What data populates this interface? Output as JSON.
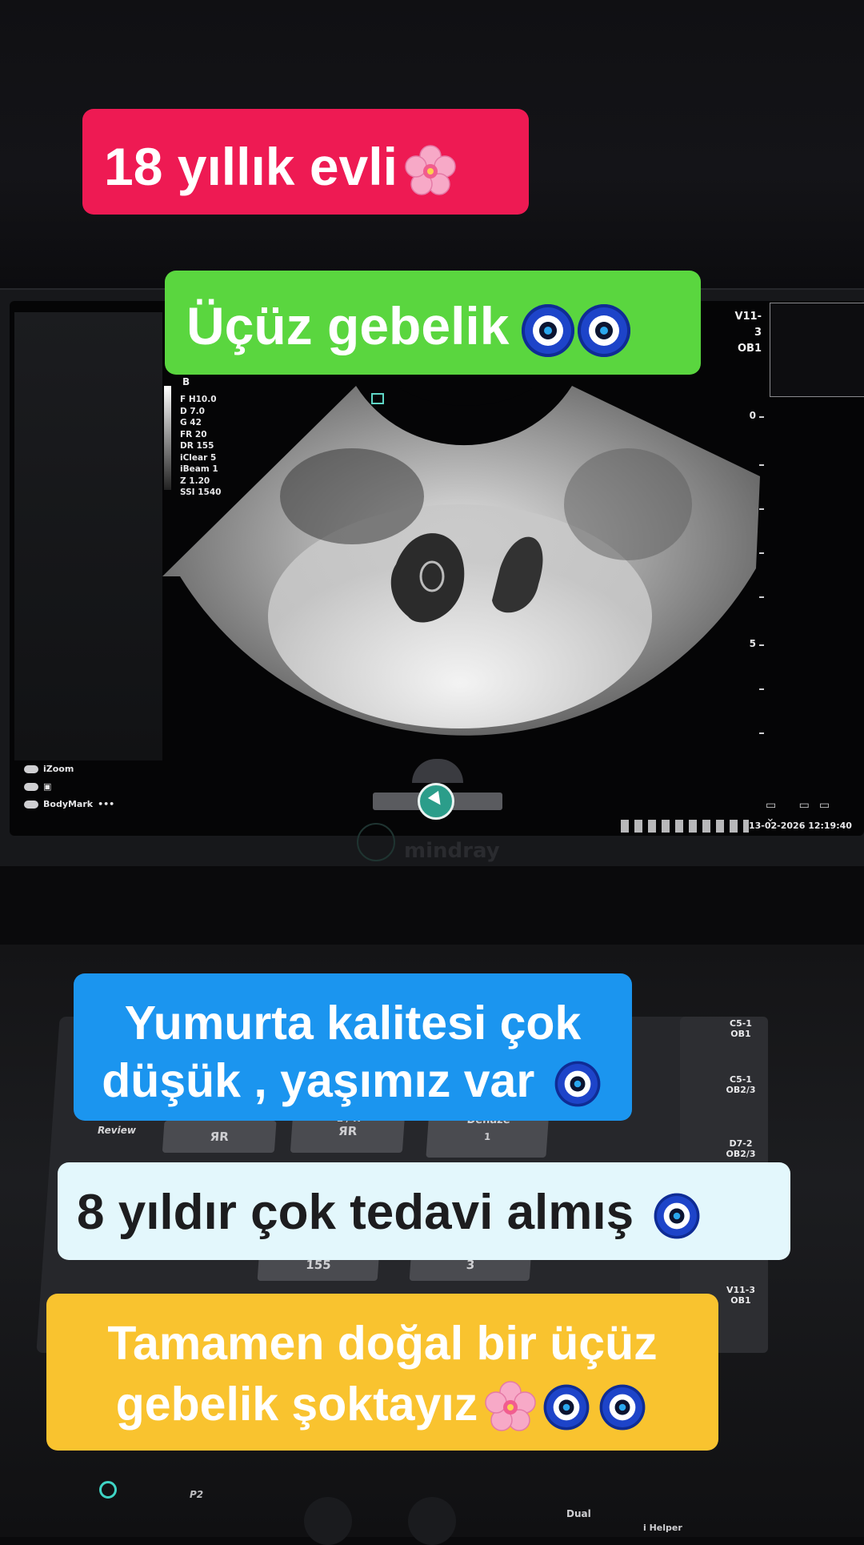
{
  "captions": {
    "c1": "18 yıllık evli",
    "c2": "Üçüz gebelik",
    "c3_line1": "Yumurta kalitesi çok",
    "c3_line2": "düşük , yaşımız var",
    "c4": "8 yıldır çok tedavi almış",
    "c5_line1": "Tamamen doğal bir üçüz",
    "c5_line2": "gebelik şoktayız"
  },
  "icons": {
    "blossom": "cherry-blossom-emoji",
    "nazar": "nazar-amulet-emoji"
  },
  "ultrasound": {
    "mode": "B",
    "params": [
      "F H10.0",
      "D 7.0",
      "G 42",
      "FR 20",
      "DR 155",
      "iClear 5",
      "iBeam 1",
      "Z 1.20",
      "SSI 1540"
    ],
    "probe": "V11-3",
    "preset": "OB1",
    "depth_labels": [
      "0",
      "5"
    ],
    "tools": [
      "iZoom",
      "",
      "BodyMark"
    ],
    "datetime": "13-02-2026  12:19:40",
    "brand": "mindray"
  },
  "console": {
    "review": "Review",
    "dehaze_label": "Dehaze",
    "dehaze_value": "1",
    "dr_value": "155",
    "key_value": "3",
    "lr_label": "L / R",
    "probes": [
      {
        "name": "C5-1",
        "preset": "OB1"
      },
      {
        "name": "C5-1",
        "preset": "OB2/3"
      },
      {
        "name": "D7-2",
        "preset": "OB2/3"
      },
      {
        "name": "V11-3",
        "preset": "OB1"
      }
    ],
    "p2": "P2",
    "dual": "Dual",
    "helper": "i Helper"
  }
}
